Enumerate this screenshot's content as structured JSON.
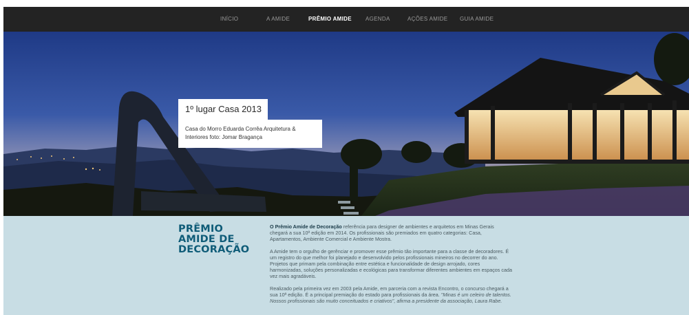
{
  "nav": {
    "items": [
      {
        "label": "INÍCIO",
        "active": false
      },
      {
        "label": "A AMIDE",
        "active": false
      },
      {
        "label": "PRÊMIO AMIDE",
        "active": true
      },
      {
        "label": "AGENDA",
        "active": false
      },
      {
        "label": "AÇÕES AMIDE",
        "active": false
      },
      {
        "label": "GUIA AMIDE",
        "active": false
      }
    ]
  },
  "slide": {
    "title": "1º lugar Casa 2013",
    "caption": "Casa do Morro Eduarda Corrêa Arquitetura & Interiores foto: Jomar Bragança",
    "active_index": 0,
    "count": 2
  },
  "award": {
    "title_line1": "PRÊMIO",
    "title_line2": "AMIDE DE",
    "title_line3": "DECORAÇÃO",
    "p1_strong": "O Prêmio Amide de Decoração",
    "p1_rest": " referência para designer de ambientes e arquitetos em Minas Gerais chegará a sua 10ª edição em 2014. Os profissionais são premiados em quatro categorias: Casa, Apartamentos, Ambiente Comercial e Ambiente Mostra.",
    "p2": "A Amide tem o orgulho de gerênciar e promover esse prêmio tão importante para a classe de decoradores. É um registro do que melhor foi planejado e desenvolvido pelos profissionais mineiros no decorrer do ano. Projetos que primam pela combinação entre estética e funcionalidade de design arrojado, cores harmonizadas, soluções personalizadas e ecológicas para transformar diferentes ambientes em espaços cada vez mais agradáveis.",
    "p3_plain": "Realizado pela primeira vez em 2003 pela Amide, em parceria com a revista Encontro, o concurso chegará a sua 10ª edição. É a principal premiação do estado para profissionais da área.",
    "p3_quote": " \"Minas é um celeiro de talentos. Nossos profissionais são muito conceituados e criativos\", afirma a presidente da associação, Laura Rabe."
  },
  "colors": {
    "nav_bg": "#232323",
    "info_bg": "#c8dde4",
    "title_color": "#0f5c78"
  }
}
